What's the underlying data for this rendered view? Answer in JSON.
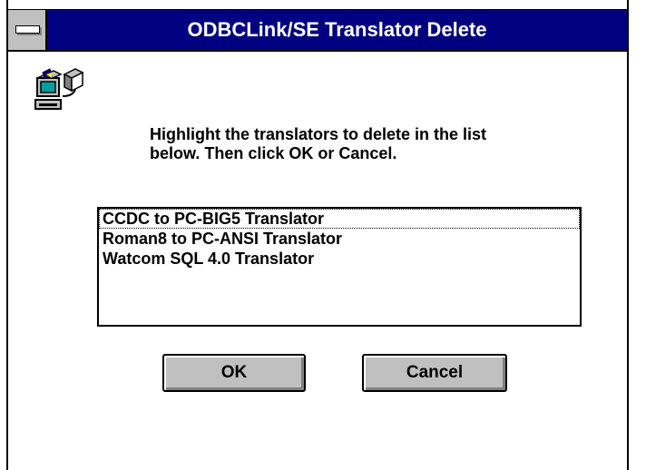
{
  "window": {
    "title": "ODBCLink/SE Translator Delete"
  },
  "instructions": "Highlight the translators to delete in the list below. Then click OK or Cancel.",
  "translators": [
    "CCDC to PC-BIG5 Translator",
    "Roman8 to PC-ANSI Translator",
    "Watcom SQL 4.0 Translator"
  ],
  "buttons": {
    "ok_label": "OK",
    "cancel_label": "Cancel"
  },
  "icons": {
    "system_menu": "system-menu-icon",
    "app": "networked-computer-icon"
  },
  "colors": {
    "titlebar": "#000080",
    "button_face": "#c0c0c0"
  }
}
